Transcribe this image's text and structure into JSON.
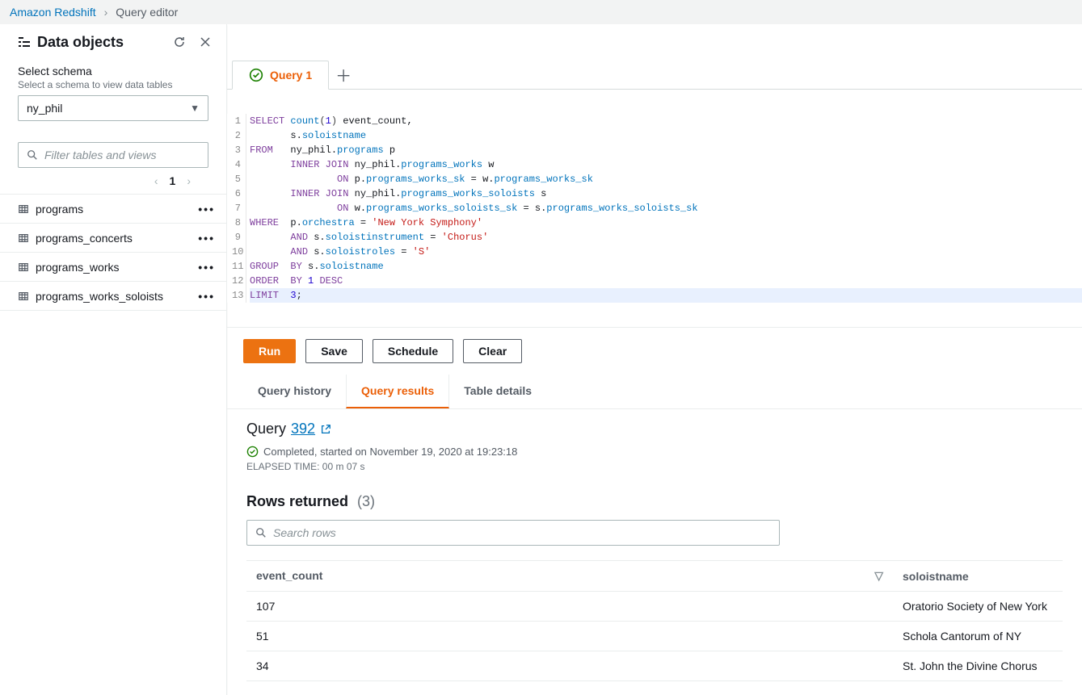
{
  "breadcrumb": {
    "service": "Amazon Redshift",
    "page": "Query editor"
  },
  "sidebar": {
    "title": "Data objects",
    "schema_label": "Select schema",
    "schema_hint": "Select a schema to view data tables",
    "schema_value": "ny_phil",
    "filter_placeholder": "Filter tables and views",
    "page_number": "1",
    "tables": [
      {
        "name": "programs"
      },
      {
        "name": "programs_concerts"
      },
      {
        "name": "programs_works"
      },
      {
        "name": "programs_works_soloists"
      }
    ]
  },
  "tabs": {
    "tab1_label": "Query 1"
  },
  "code": {
    "lines": [
      [
        {
          "t": "SELECT",
          "c": "kw"
        },
        {
          "t": " "
        },
        {
          "t": "count",
          "c": "fn"
        },
        {
          "t": "(",
          "c": "op"
        },
        {
          "t": "1",
          "c": "num"
        },
        {
          "t": ")",
          "c": "op"
        },
        {
          "t": " event_count,"
        }
      ],
      [
        {
          "t": "       s."
        },
        {
          "t": "soloistname",
          "c": "id"
        }
      ],
      [
        {
          "t": "FROM",
          "c": "kw"
        },
        {
          "t": "   ny_phil."
        },
        {
          "t": "programs",
          "c": "id"
        },
        {
          "t": " p"
        }
      ],
      [
        {
          "t": "       "
        },
        {
          "t": "INNER",
          "c": "kw"
        },
        {
          "t": " "
        },
        {
          "t": "JOIN",
          "c": "kw"
        },
        {
          "t": " ny_phil."
        },
        {
          "t": "programs_works",
          "c": "id"
        },
        {
          "t": " w"
        }
      ],
      [
        {
          "t": "               "
        },
        {
          "t": "ON",
          "c": "kw"
        },
        {
          "t": " p."
        },
        {
          "t": "programs_works_sk",
          "c": "id"
        },
        {
          "t": " = w."
        },
        {
          "t": "programs_works_sk",
          "c": "id"
        }
      ],
      [
        {
          "t": "       "
        },
        {
          "t": "INNER",
          "c": "kw"
        },
        {
          "t": " "
        },
        {
          "t": "JOIN",
          "c": "kw"
        },
        {
          "t": " ny_phil."
        },
        {
          "t": "programs_works_soloists",
          "c": "id"
        },
        {
          "t": " s"
        }
      ],
      [
        {
          "t": "               "
        },
        {
          "t": "ON",
          "c": "kw"
        },
        {
          "t": " w."
        },
        {
          "t": "programs_works_soloists_sk",
          "c": "id"
        },
        {
          "t": " = s."
        },
        {
          "t": "programs_works_soloists_sk",
          "c": "id"
        }
      ],
      [
        {
          "t": "WHERE",
          "c": "kw"
        },
        {
          "t": "  p."
        },
        {
          "t": "orchestra",
          "c": "id"
        },
        {
          "t": " = "
        },
        {
          "t": "'New York Symphony'",
          "c": "str"
        }
      ],
      [
        {
          "t": "       "
        },
        {
          "t": "AND",
          "c": "kw"
        },
        {
          "t": " s."
        },
        {
          "t": "soloistinstrument",
          "c": "id"
        },
        {
          "t": " = "
        },
        {
          "t": "'Chorus'",
          "c": "str"
        }
      ],
      [
        {
          "t": "       "
        },
        {
          "t": "AND",
          "c": "kw"
        },
        {
          "t": " s."
        },
        {
          "t": "soloistroles",
          "c": "id"
        },
        {
          "t": " = "
        },
        {
          "t": "'S'",
          "c": "str"
        }
      ],
      [
        {
          "t": "GROUP",
          "c": "kw"
        },
        {
          "t": "  "
        },
        {
          "t": "BY",
          "c": "kw"
        },
        {
          "t": " s."
        },
        {
          "t": "soloistname",
          "c": "id"
        }
      ],
      [
        {
          "t": "ORDER",
          "c": "kw"
        },
        {
          "t": "  "
        },
        {
          "t": "BY",
          "c": "kw"
        },
        {
          "t": " "
        },
        {
          "t": "1",
          "c": "num"
        },
        {
          "t": " "
        },
        {
          "t": "DESC",
          "c": "kw"
        }
      ],
      [
        {
          "t": "LIMIT",
          "c": "kw"
        },
        {
          "t": "  "
        },
        {
          "t": "3",
          "c": "num"
        },
        {
          "t": ";"
        }
      ]
    ]
  },
  "actions": {
    "run": "Run",
    "save": "Save",
    "schedule": "Schedule",
    "clear": "Clear"
  },
  "results": {
    "tabs": {
      "history": "Query history",
      "results": "Query results",
      "details": "Table details"
    },
    "heading_prefix": "Query",
    "query_id": "392",
    "status": "Completed, started on November 19, 2020 at 19:23:18",
    "elapsed": "ELAPSED TIME: 00 m 07 s",
    "rows_heading": "Rows returned",
    "rows_count": "(3)",
    "search_placeholder": "Search rows",
    "columns": [
      "event_count",
      "soloistname"
    ],
    "rows": [
      {
        "event_count": "107",
        "soloistname": "Oratorio Society of New York"
      },
      {
        "event_count": "51",
        "soloistname": "Schola Cantorum of NY"
      },
      {
        "event_count": "34",
        "soloistname": "St. John the Divine Chorus"
      }
    ]
  }
}
